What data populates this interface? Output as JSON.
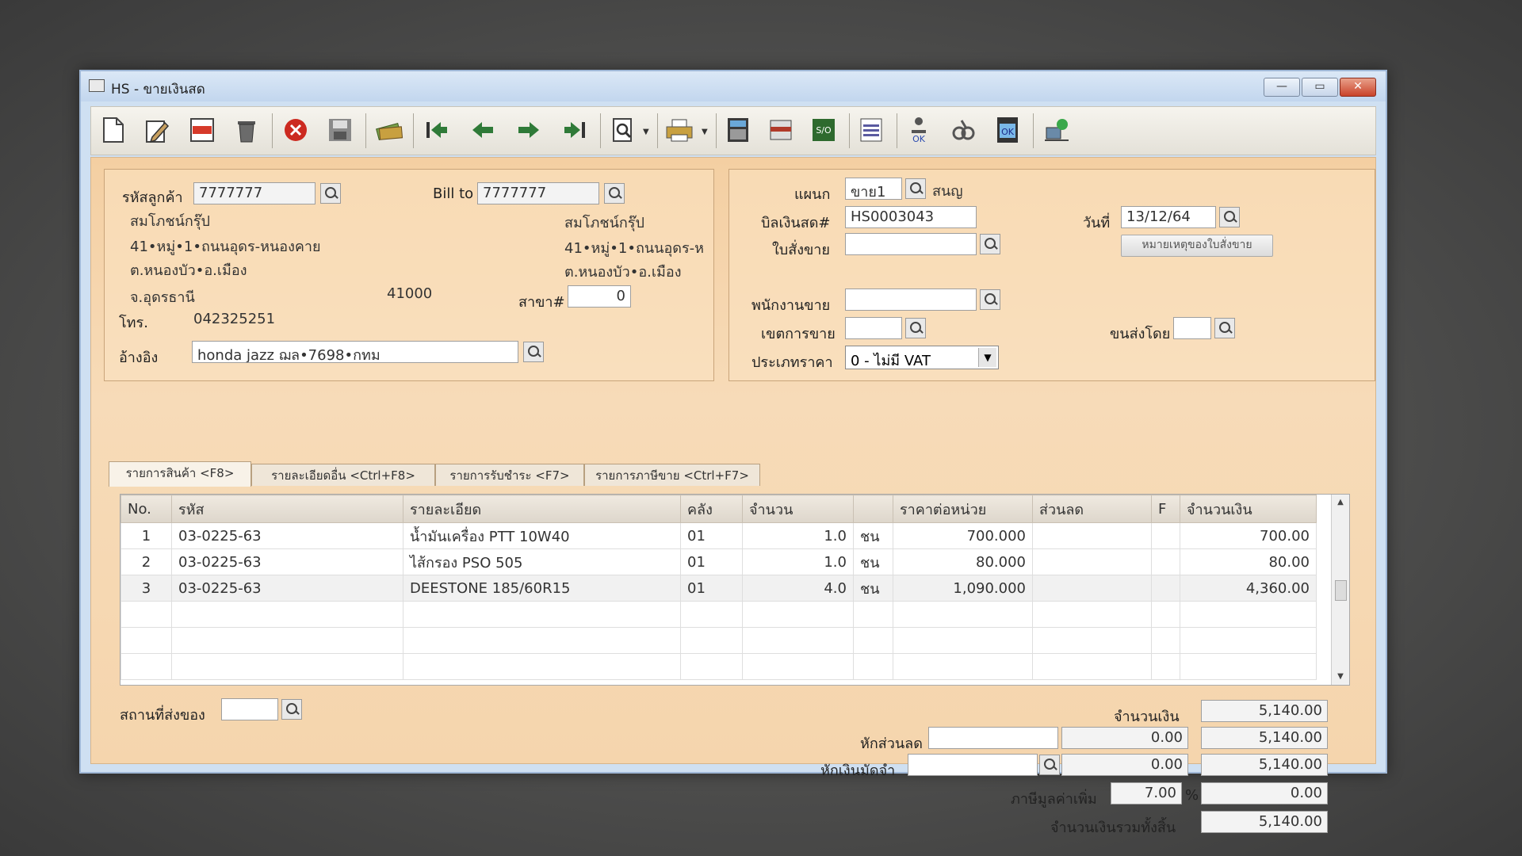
{
  "window": {
    "title": "HS - ขายเงินสด"
  },
  "window_controls": {
    "minimize": "—",
    "maximize": "▭",
    "close": "✕"
  },
  "toolbar": {
    "icons": [
      "new-doc-icon",
      "edit-icon",
      "void-icon",
      "trash-icon",
      "cancel-icon",
      "save-icon",
      "money-icon",
      "first-record-icon",
      "prev-record-icon",
      "next-record-icon",
      "last-record-icon",
      "search-doc-icon",
      "print-icon",
      "calculator-icon",
      "card-icon",
      "so-icon",
      "report-icon",
      "user-ok-icon",
      "tools-icon",
      "ok-icon",
      "network-icon"
    ]
  },
  "customer": {
    "code_label": "รหัสลูกค้า",
    "code": "7777777",
    "name": "สมโภชน์กรุ๊ป",
    "addr1": "41•หมู่•1•ถนนอุดร-หนองคาย",
    "addr2": "ต.หนองบัว•อ.เมือง",
    "province": "จ.อุดรธานี",
    "zip": "41000",
    "tel_label": "โทร.",
    "tel": "042325251",
    "ref_label": "อ้างอิง",
    "ref": "honda jazz ฌล•7698•กทม"
  },
  "bill_to": {
    "label": "Bill to",
    "code": "7777777",
    "name": "สมโภชน์กรุ๊ป",
    "addr1": "41•หมู่•1•ถนนอุดร-ห",
    "addr2": "ต.หนองบัว•อ.เมือง",
    "branch_label": "สาขา#",
    "branch": "0"
  },
  "doc": {
    "dept_label": "แผนก",
    "dept": "ขาย1",
    "dept_name": "สนญ",
    "bill_label": "บิลเงินสด#",
    "bill_no": "HS0003043",
    "date_label": "วันที่",
    "date": "13/12/64",
    "so_label": "ใบสั่งขาย",
    "so_note_button": "หมายเหตุของใบสั่งขาย",
    "salesman_label": "พนักงานขาย",
    "area_label": "เขตการขาย",
    "ship_label": "ขนส่งโดย",
    "price_type_label": "ประเภทราคา",
    "price_type": "0 - ไม่มี VAT"
  },
  "tabs": [
    "รายการสินค้า <F8>",
    "รายละเอียดอื่น <Ctrl+F8>",
    "รายการรับชำระ <F7>",
    "รายการภาษีขาย <Ctrl+F7>"
  ],
  "grid": {
    "columns": {
      "no": "No.",
      "code": "รหัส",
      "desc": "รายละเอียด",
      "wh": "คลัง",
      "qty": "จำนวน",
      "price": "ราคาต่อหน่วย",
      "disc": "ส่วนลด",
      "f": "F",
      "amount": "จำนวนเงิน"
    },
    "rows": [
      {
        "no": "1",
        "code": "03-0225-63",
        "desc": "น้ำมันเครื่อง PTT 10W40",
        "wh": "01",
        "qty": "1.0",
        "unit": "ชน",
        "price": "700.000",
        "disc": "",
        "f": "",
        "amount": "700.00"
      },
      {
        "no": "2",
        "code": "03-0225-63",
        "desc": "ไส้กรอง PSO 505",
        "wh": "01",
        "qty": "1.0",
        "unit": "ชน",
        "price": "80.000",
        "disc": "",
        "f": "",
        "amount": "80.00"
      },
      {
        "no": "3",
        "code": "03-0225-63",
        "desc": "DEESTONE 185/60R15",
        "wh": "01",
        "qty": "4.0",
        "unit": "ชน",
        "price": "1,090.000",
        "disc": "",
        "f": "",
        "amount": "4,360.00"
      }
    ]
  },
  "footer": {
    "delivery_label": "สถานที่ส่งของ",
    "amount_label": "จำนวนเงิน",
    "amount": "5,140.00",
    "discount_label": "หักส่วนลด",
    "discount": "0.00",
    "after_discount": "5,140.00",
    "deposit_label": "หักเงินมัดจำ",
    "deposit": "0.00",
    "after_deposit": "5,140.00",
    "vat_label": "ภาษีมูลค่าเพิ่ม",
    "vat_rate": "7.00",
    "vat_pct": "%",
    "vat_amount": "0.00",
    "total_label": "จำนวนเงินรวมทั้งสิ้น",
    "total": "5,140.00"
  }
}
